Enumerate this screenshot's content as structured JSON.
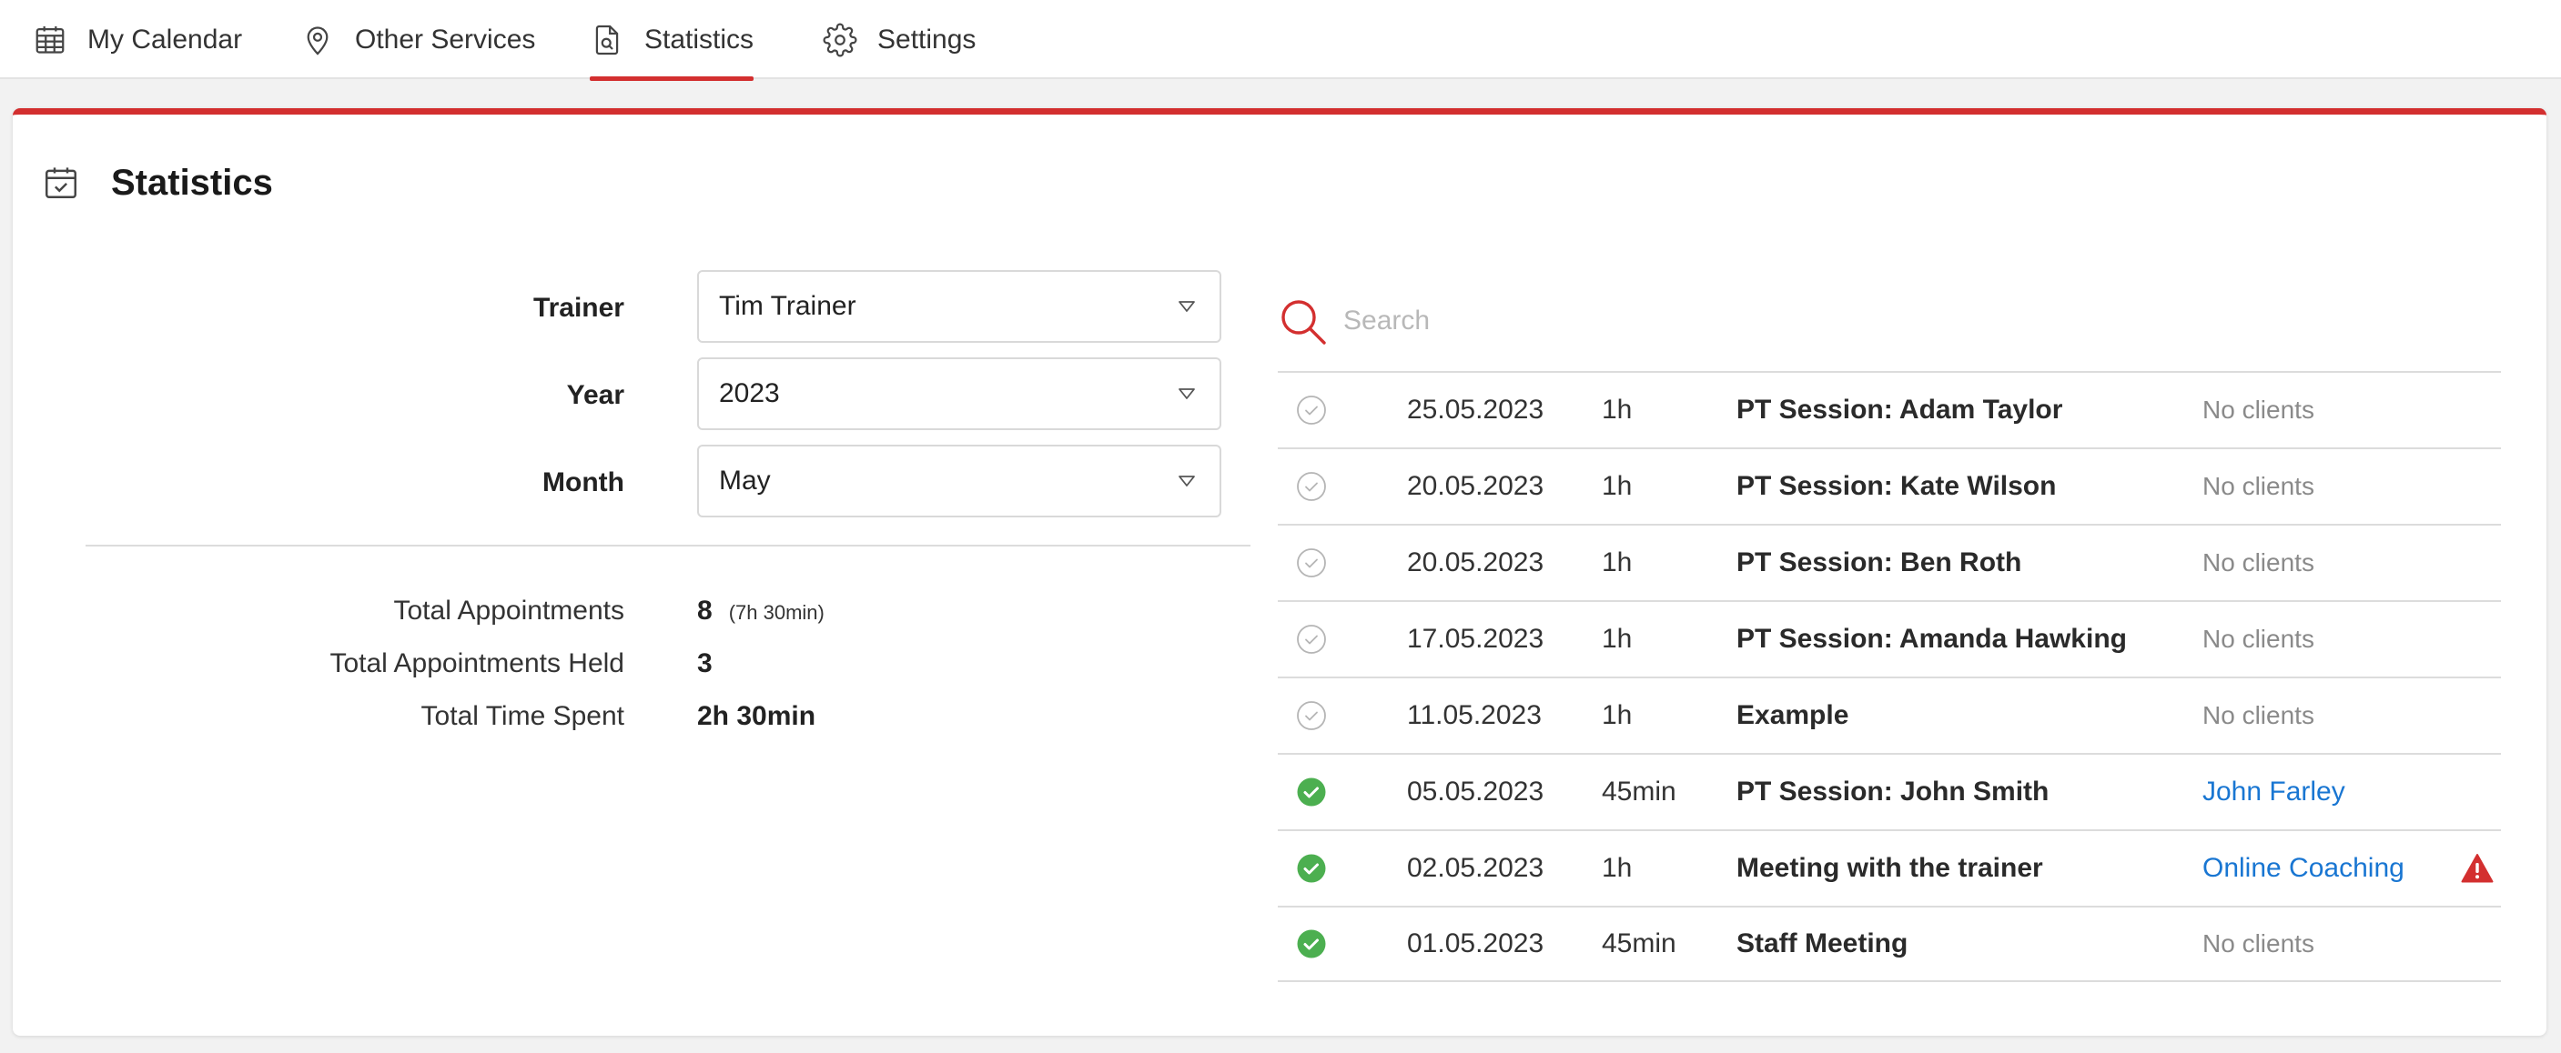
{
  "nav": {
    "tabs": [
      {
        "label": "My Calendar",
        "icon": "calendar-icon"
      },
      {
        "label": "Other Services",
        "icon": "location-pin-icon"
      },
      {
        "label": "Statistics",
        "icon": "document-search-icon",
        "active": true
      },
      {
        "label": "Settings",
        "icon": "gear-icon"
      }
    ]
  },
  "card": {
    "title": "Statistics",
    "icon": "calendar-check-icon"
  },
  "filters": {
    "trainer": {
      "label": "Trainer",
      "value": "Tim Trainer"
    },
    "year": {
      "label": "Year",
      "value": "2023"
    },
    "month": {
      "label": "Month",
      "value": "May"
    }
  },
  "summary": {
    "total_appointments": {
      "label": "Total Appointments",
      "value": "8",
      "detail": "(7h 30min)"
    },
    "total_held": {
      "label": "Total Appointments Held",
      "value": "3"
    },
    "total_time": {
      "label": "Total Time Spent",
      "value": "2h 30min"
    }
  },
  "search": {
    "placeholder": "Search"
  },
  "appointments": [
    {
      "held": false,
      "date": "25.05.2023",
      "duration": "1h",
      "title": "PT Session: Adam Taylor",
      "client": "No clients",
      "client_link": false,
      "warning": false
    },
    {
      "held": false,
      "date": "20.05.2023",
      "duration": "1h",
      "title": "PT Session: Kate Wilson",
      "client": "No clients",
      "client_link": false,
      "warning": false
    },
    {
      "held": false,
      "date": "20.05.2023",
      "duration": "1h",
      "title": "PT Session: Ben Roth",
      "client": "No clients",
      "client_link": false,
      "warning": false
    },
    {
      "held": false,
      "date": "17.05.2023",
      "duration": "1h",
      "title": "PT Session: Amanda Hawking",
      "client": "No clients",
      "client_link": false,
      "warning": false
    },
    {
      "held": false,
      "date": "11.05.2023",
      "duration": "1h",
      "title": "Example",
      "client": "No clients",
      "client_link": false,
      "warning": false
    },
    {
      "held": true,
      "date": "05.05.2023",
      "duration": "45min",
      "title": "PT Session: John Smith",
      "client": "John Farley",
      "client_link": true,
      "warning": false
    },
    {
      "held": true,
      "date": "02.05.2023",
      "duration": "1h",
      "title": "Meeting with the trainer",
      "client": "Online Coaching",
      "client_link": true,
      "warning": true
    },
    {
      "held": true,
      "date": "01.05.2023",
      "duration": "45min",
      "title": "Staff Meeting",
      "client": "No clients",
      "client_link": false,
      "warning": false
    }
  ],
  "colors": {
    "accent": "#d32f2f",
    "held": "#4caf50",
    "link": "#1976d2",
    "warning": "#d32f2f"
  }
}
